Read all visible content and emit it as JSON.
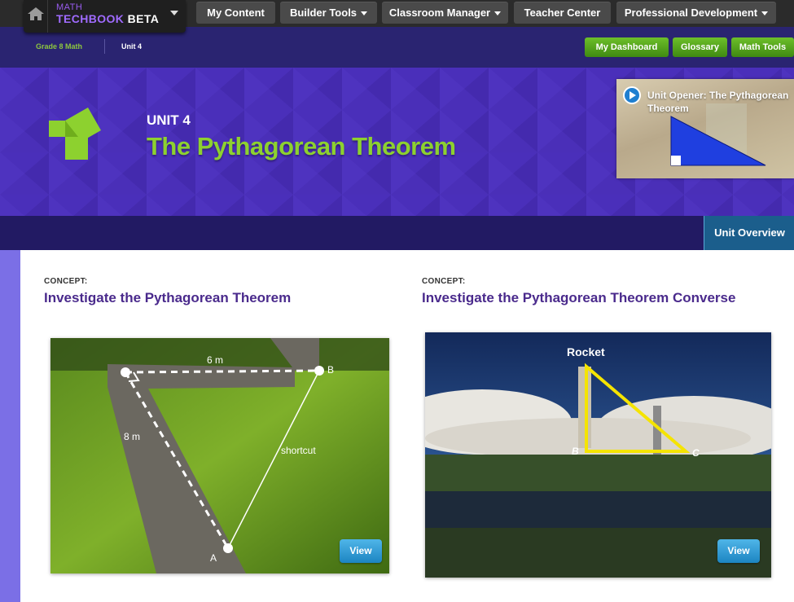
{
  "topnav": {
    "brand_line1": "MATH",
    "brand_techbook": "TECHBOOK",
    "brand_beta": " BETA",
    "items": [
      {
        "label": "My Content",
        "dropdown": false
      },
      {
        "label": "Builder Tools",
        "dropdown": true
      },
      {
        "label": "Classroom Manager",
        "dropdown": true
      },
      {
        "label": "Teacher Center",
        "dropdown": false
      },
      {
        "label": "Professional Development",
        "dropdown": true
      }
    ]
  },
  "breadcrumb": {
    "items": [
      "Grade 8 Math",
      "Unit 4"
    ]
  },
  "quick_buttons": [
    "My Dashboard",
    "Glossary",
    "Math Tools"
  ],
  "banner": {
    "unit_label": "UNIT 4",
    "unit_title": "The Pythagorean Theorem",
    "video_title": "Unit Opener: The Pythagorean Theorem"
  },
  "tabs": {
    "unit_overview": "Unit Overview"
  },
  "concepts": [
    {
      "label": "CONCEPT:",
      "title": "Investigate the Pythagorean Theorem",
      "image_labels": {
        "top": "6 m",
        "side": "8 m",
        "diag": "shortcut",
        "pointA": "A",
        "pointB": "B"
      },
      "button": "View"
    },
    {
      "label": "CONCEPT:",
      "title": "Investigate the Pythagorean Theorem Converse",
      "image_labels": {
        "top": "Rocket",
        "pointB": "B",
        "pointC": "C"
      },
      "button": "View"
    }
  ],
  "colors": {
    "nav_bg": "#2b2b2b",
    "banner_bg": "#4a2fb8",
    "title_green": "#8dd12f",
    "button_green": "#5aa91f",
    "concept_purple": "#4a2a8c",
    "view_blue": "#2a95d0"
  },
  "icons": {
    "home": "home-icon",
    "play": "play-circle-icon",
    "logo": "pythagorean-squares-logo"
  }
}
